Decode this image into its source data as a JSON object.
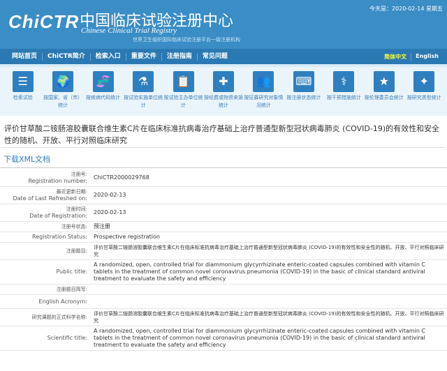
{
  "header": {
    "logo": "ChiCTR",
    "cn_title": "中国临床试验注册中心",
    "en_title": "Chinese Clinical Trial Registry",
    "subtitle": "世界卫生组织国际临床试验注册平台一级注册机构",
    "today": "今天是：2020-02-14 星期五"
  },
  "nav": {
    "items": [
      "网站首页",
      "ChiCTR简介",
      "检索入口",
      "重要文件",
      "注册指南",
      "常见问题"
    ],
    "lang_cn": "简体中文",
    "lang_en": "English"
  },
  "icons": [
    {
      "label": "检索试验",
      "glyph": "☰"
    },
    {
      "label": "按国家、省（市）统计",
      "glyph": "🌍"
    },
    {
      "label": "按疾病代码统计",
      "glyph": "🧬"
    },
    {
      "label": "按试验实施单位统计",
      "glyph": "⚗"
    },
    {
      "label": "按试验主办单位统计",
      "glyph": "📋"
    },
    {
      "label": "按经费或物资来源统计",
      "glyph": "✚"
    },
    {
      "label": "按征募研究对象情况统计",
      "glyph": "👥"
    },
    {
      "label": "按注册状态统计",
      "glyph": "⌨"
    },
    {
      "label": "按干预措施统计",
      "glyph": "⚕"
    },
    {
      "label": "按伦理委员会统计",
      "glyph": "★"
    },
    {
      "label": "按研究类型统计",
      "glyph": "✦"
    }
  ],
  "page_title": "评价甘草酸二铵肠溶胶囊联合维生素C片在临床标准抗病毒治疗基础上治疗普通型新型冠状病毒肺炎 (COVID-19)的有效性和安全性的随机、开放、平行对照临床研究",
  "download": "下载XML文档",
  "rows": [
    {
      "cn": "注册号:",
      "en": "Registration number:",
      "value": "ChiCTR2000029768"
    },
    {
      "cn": "最近更新日期:",
      "en": "Date of Last Refreshed on:",
      "value": "2020-02-13"
    },
    {
      "cn": "注册时间:",
      "en": "Date of Registration:",
      "value": "2020-02-13"
    },
    {
      "cn": "注册号状态:",
      "en": "",
      "value": "预注册"
    },
    {
      "cn": "",
      "en": "Registration Status:",
      "value": "Prospective registration"
    },
    {
      "cn": "注册题目:",
      "en": "",
      "value": "评价甘草酸二铵肠溶胶囊联合维生素C片在临床标准抗病毒治疗基础上治疗普通型新型冠状病毒肺炎 (COVID-19)的有效性和安全性的随机、开放、平行对照临床研究"
    },
    {
      "cn": "",
      "en": "Public title:",
      "value": "A randomized, open, controlled trial for diammonium glycyrrhizinate enteric-coated capsules combined with vitamin C tablets in the treatment of common novel coronavirus pneumonia (COVID-19) in the basic of clinical standard antiviral treatment to evaluate the safety and efficiency"
    },
    {
      "cn": "注册题目简写:",
      "en": "",
      "value": ""
    },
    {
      "cn": "",
      "en": "English Acronym:",
      "value": ""
    },
    {
      "cn": "研究课题的正式科学名称:",
      "en": "",
      "value": "评价甘草酸二铵肠溶胶囊联合维生素C片在临床标准抗病毒治疗基础上治疗普通型新型冠状病毒肺炎 (COVID-19)的有效性和安全性的随机、开放、平行对照临床研究"
    },
    {
      "cn": "",
      "en": "Scientific title:",
      "value": "A randomized, open, controlled trial for diammonium glycyrrhizinate enteric-coated capsules combined with vitamin C tablets in the treatment of common novel coronavirus pneumonia (COVID-19) in the basic of clinical standard antiviral treatment to evaluate the safety and efficiency"
    }
  ]
}
